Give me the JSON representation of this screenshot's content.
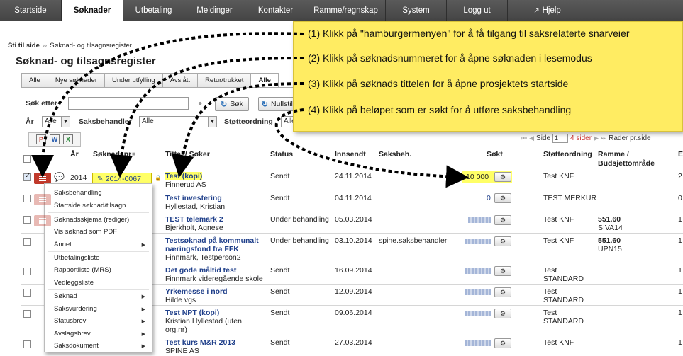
{
  "nav": {
    "tabs": [
      "Startside",
      "Søknader",
      "Utbetaling",
      "Meldinger",
      "Kontakter",
      "Ramme/regnskap",
      "System",
      "Logg ut",
      "Hjelp"
    ]
  },
  "breadcrumb": {
    "home": "Sti til side",
    "current": "Søknad- og tilsagnsregister"
  },
  "page_title": "Søknad- og tilsagnsregister",
  "subtabs": [
    "Alle",
    "Nye søknader",
    "Under utfylling",
    "Avslått",
    "Retur/trukket",
    "Alle"
  ],
  "search": {
    "search_label": "Søk etter",
    "search_button": "Søk",
    "reset_button": "Nullstill",
    "year_label": "År",
    "year_value": "Alle",
    "handler_label": "Saksbehandler",
    "handler_value": "Alle",
    "scheme_label": "Støtteordning",
    "scheme_value": "Alle"
  },
  "pager": {
    "page_label": "Side",
    "page_value": "1",
    "pages": "4 sider",
    "rows_label": "Rader pr.side"
  },
  "table": {
    "headers": {
      "year": "År",
      "number": "Søknadsnr",
      "title": "Tittel / Søker",
      "status": "Status",
      "sent": "Innsendt",
      "handler": "Saksbeh.",
      "amount": "Søkt",
      "scheme": "Støtteordning",
      "budget": "Ramme / Budsjettområde",
      "extra": "E"
    },
    "first_row": {
      "year": "2014",
      "number": "2014-0067"
    },
    "rows": [
      {
        "title": "Test (kopi)",
        "applicant": "Finnerud AS",
        "status": "Sendt",
        "sent": "24.11.2014",
        "handler": "",
        "amount": "10 000",
        "scheme": "Test KNF",
        "budget": "",
        "budget_sub": "",
        "extra": "2"
      },
      {
        "title": "Test investering",
        "applicant": "Hyllestad, Kristian",
        "status": "Sendt",
        "sent": "04.11.2014",
        "handler": "",
        "amount": "0",
        "scheme": "TEST MERKUR",
        "budget": "",
        "budget_sub": "",
        "extra": "0"
      },
      {
        "title": "TEST telemark 2",
        "applicant": "Bjerkholt, Agnese",
        "status": "Under behandling",
        "sent": "05.03.2014",
        "handler": "",
        "amount": "",
        "scheme": "Test KNF",
        "budget": "551.60",
        "budget_sub": "SIVA14",
        "extra": "1"
      },
      {
        "title": "Testsøknad på kommunalt",
        "title2": "næringsfond fra FFK",
        "applicant": "Finnmark, Testperson2",
        "status": "Under behandling",
        "sent": "03.10.2014",
        "handler": "spine.saksbehandler",
        "amount": "",
        "scheme": "Test KNF",
        "budget": "551.60",
        "budget_sub": "UPN15",
        "extra": "1"
      },
      {
        "title": "Det gode måltid test",
        "applicant": "Finnmark videregående skole",
        "status": "Sendt",
        "sent": "16.09.2014",
        "handler": "",
        "amount": "",
        "scheme": "Test",
        "scheme2": "STANDARD",
        "budget": "",
        "budget_sub": "",
        "extra": "1"
      },
      {
        "title": "Yrkemesse i nord",
        "applicant": "Hilde vgs",
        "status": "Sendt",
        "sent": "12.09.2014",
        "handler": "",
        "amount": "",
        "scheme": "Test",
        "scheme2": "STANDARD",
        "budget": "",
        "budget_sub": "",
        "extra": "1"
      },
      {
        "title": "Test NPT (kopi)",
        "applicant": "Kristian Hyllestad (uten",
        "applicant2": "org.nr)",
        "status": "Sendt",
        "sent": "09.06.2014",
        "handler": "",
        "amount": "",
        "scheme": "Test",
        "scheme2": "STANDARD",
        "budget": "",
        "budget_sub": "",
        "extra": "1"
      },
      {
        "title": "Test kurs M&R 2013",
        "applicant": "SPINE AS",
        "status": "Sendt",
        "sent": "27.03.2014",
        "handler": "",
        "amount": "",
        "scheme": "Test KNF",
        "budget": "",
        "budget_sub": "",
        "extra": "1"
      }
    ]
  },
  "menu": {
    "items": [
      "Saksbehandling",
      "Startside søknad/tilsagn",
      "Søknadsskjema (rediger)",
      "Vis søknad som PDF",
      "Annet",
      "Utbetalingsliste",
      "Rapportliste (MRS)",
      "Vedleggsliste",
      "Søknad",
      "Saksvurdering",
      "Statusbrev",
      "Avslagsbrev",
      "Saksdokument"
    ]
  },
  "callout": {
    "lines": [
      "(1) Klikk på \"hamburgermenyen\" for å få tilgang til saksrelaterte snarveier",
      "(2) Klikk på søknadsnummeret for å åpne søknaden i lesemodus",
      "(3) Klikk på søknads tittelen for å åpne prosjektets startside",
      "(4) Klikk på beløpet som er søkt for å utføre saksbehandling"
    ]
  },
  "icons": {
    "hamburger": "hamburger-menu-icon",
    "comment": "comment-icon",
    "pencil": "pencil-icon",
    "lock": "lock-icon",
    "gear": "gear-icon",
    "external": "external-link-icon"
  },
  "colors": {
    "accent_red": "#c0392b",
    "highlight_yellow": "#ffff66",
    "callout_yellow": "#ffec62",
    "link_blue": "#1f3f8a"
  }
}
